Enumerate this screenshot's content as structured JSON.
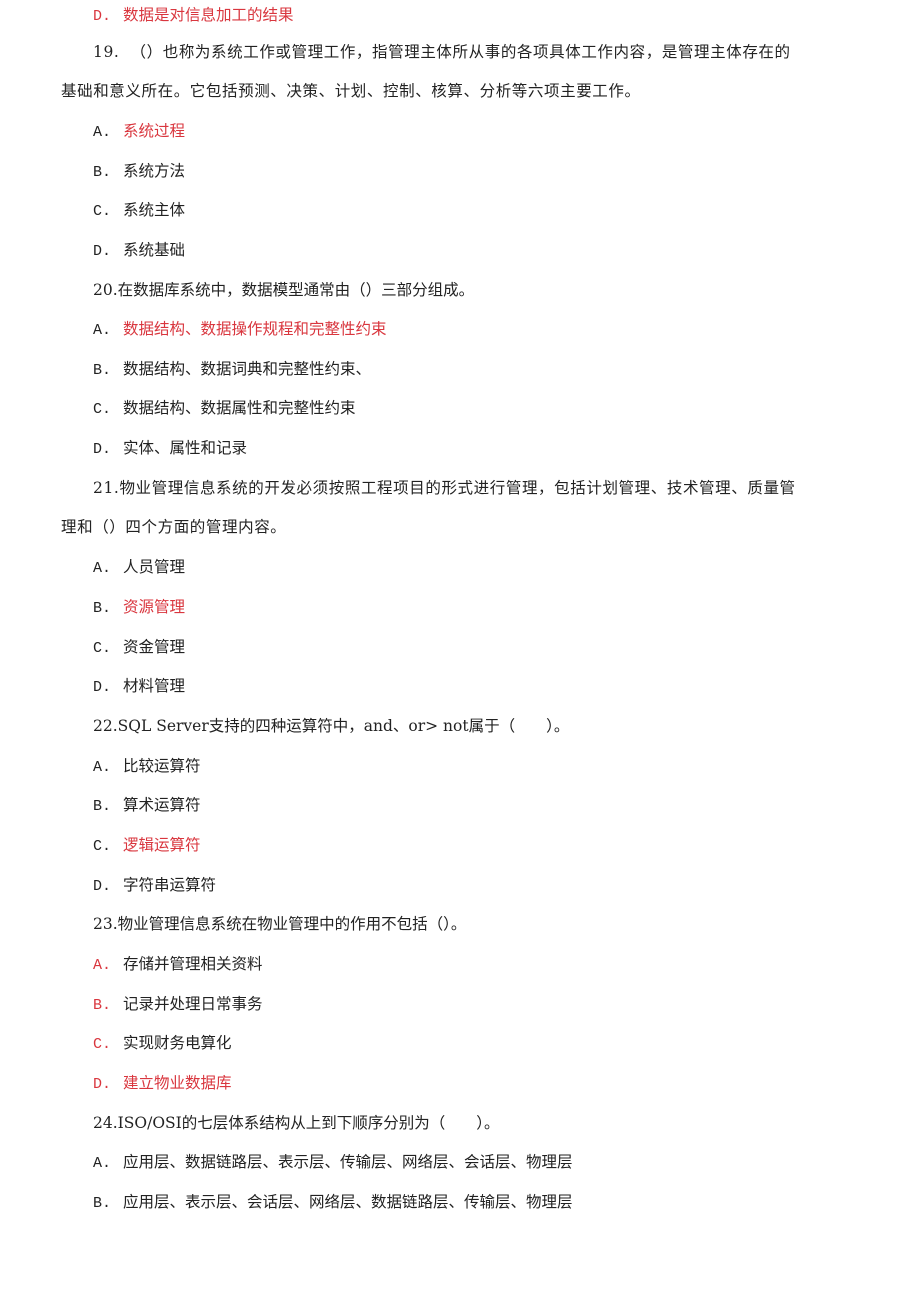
{
  "colors": {
    "answer": "#d9363e",
    "text": "#222222"
  },
  "prev_option": {
    "label": "D.",
    "text": "数据是对信息加工的结果",
    "label_red": true,
    "text_red": true
  },
  "questions": [
    {
      "number": "19.",
      "stem_line1": "（）也称为系统工作或管理工作，指管理主体所从事的各项具体工作内容，是管理主体存在的",
      "stem_line2": "基础和意义所在。它包括预测、决策、计划、控制、核算、分析等六项主要工作。",
      "options": [
        {
          "label": "A.",
          "text": "系统过程"
        },
        {
          "label": "B.",
          "text": "系统方法"
        },
        {
          "label": "C.",
          "text": "系统主体"
        },
        {
          "label": "D.",
          "text": "系统基础"
        }
      ]
    },
    {
      "number": "20.",
      "stem_line1": "在数据库系统中，数据模型通常由（）三部分组成。",
      "options": [
        {
          "label": "A.",
          "text": "数据结构、数据操作规程和完整性约束"
        },
        {
          "label": "B.",
          "text": "数据结构、数据词典和完整性约束、"
        },
        {
          "label": "C.",
          "text": "数据结构、数据属性和完整性约束"
        },
        {
          "label": "D.",
          "text": "实体、属性和记录"
        }
      ]
    },
    {
      "number": "21.",
      "stem_line1": "物业管理信息系统的开发必须按照工程项目的形式进行管理，包括计划管理、技术管理、质量管",
      "stem_line2": "理和（）四个方面的管理内容。",
      "options": [
        {
          "label": "A.",
          "text": "人员管理"
        },
        {
          "label": "B.",
          "text": "资源管理"
        },
        {
          "label": "C.",
          "text": "资金管理"
        },
        {
          "label": "D.",
          "text": "材料管理"
        }
      ]
    },
    {
      "number": "22.",
      "stem_line1": "SQL Server支持的四种运算符中，and、or> not属于（　　）。",
      "options": [
        {
          "label": "A.",
          "text": "比较运算符"
        },
        {
          "label": "B.",
          "text": "算术运算符"
        },
        {
          "label": "C.",
          "text": "逻辑运算符"
        },
        {
          "label": "D.",
          "text": "字符串运算符"
        }
      ]
    },
    {
      "number": "23.",
      "stem_line1": "物业管理信息系统在物业管理中的作用不包括（）。",
      "options": [
        {
          "label": "A.",
          "text": "存储并管理相关资料"
        },
        {
          "label": "B.",
          "text": "记录并处理日常事务"
        },
        {
          "label": "C.",
          "text": "实现财务电算化"
        },
        {
          "label": "D.",
          "text": "建立物业数据库"
        }
      ]
    },
    {
      "number": "24.",
      "stem_line1": "ISO/OSI的七层体系结构从上到下顺序分别为（　　）。",
      "options": [
        {
          "label": "A.",
          "text": "应用层、数据链路层、表示层、传输层、网络层、会话层、物理层"
        },
        {
          "label": "B.",
          "text": "应用层、表示层、会话层、网络层、数据链路层、传输层、物理层"
        }
      ]
    }
  ]
}
